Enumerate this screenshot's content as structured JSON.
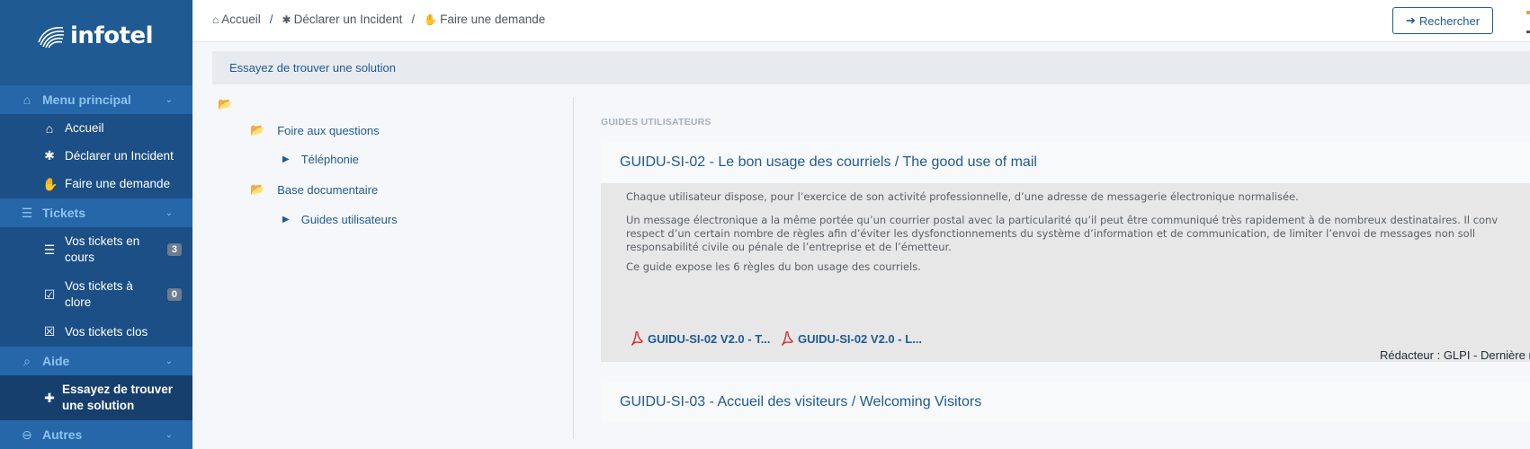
{
  "app": {
    "logo_text": "infotel"
  },
  "sidebar": {
    "sections": [
      {
        "label": "Menu principal",
        "icon": "home-icon"
      },
      {
        "label": "Tickets",
        "icon": "list-icon"
      },
      {
        "label": "Aide",
        "icon": "search-help-icon"
      },
      {
        "label": "Autres",
        "icon": "minus-circle-icon"
      }
    ],
    "items": [
      {
        "label": "Accueil",
        "icon": "home-icon"
      },
      {
        "label": "Déclarer un Incident",
        "icon": "bug-icon"
      },
      {
        "label": "Faire une demande",
        "icon": "handshake-icon"
      },
      {
        "label": "Vos tickets en cours",
        "label_l1": "Vos tickets en",
        "label_l2": "cours",
        "badge": "3",
        "icon": "list-icon"
      },
      {
        "label": "Vos tickets à clore",
        "label_l1": "Vos tickets à",
        "label_l2": "clore",
        "badge": "0",
        "icon": "checklist-icon"
      },
      {
        "label": "Vos tickets clos",
        "icon": "close-box-icon"
      },
      {
        "label": "Essayez de trouver une solution",
        "label_l1": "Essayez de trouver",
        "label_l2": "une solution",
        "icon": "medkit-icon"
      }
    ]
  },
  "breadcrumb": {
    "items": [
      {
        "label": "Accueil",
        "icon": "home-icon"
      },
      {
        "label": "Déclarer un Incident",
        "icon": "bug-icon"
      },
      {
        "label": "Faire une demande",
        "icon": "handshake-icon"
      }
    ],
    "separator": "/"
  },
  "search_button": {
    "label": "Rechercher",
    "icon": "arrow-right-icon"
  },
  "solution_header": "Essayez de trouver une solution",
  "tree": {
    "nodes": [
      {
        "label": "Foire aux questions",
        "icon": "folder-open-icon"
      },
      {
        "label": "Téléphonie",
        "icon": "caret-right-icon"
      },
      {
        "label": "Base documentaire",
        "icon": "folder-open-icon"
      },
      {
        "label": "Guides utilisateurs",
        "icon": "caret-right-icon"
      }
    ]
  },
  "content": {
    "group_title": "GUIDES UTILISATEURS",
    "articles": [
      {
        "title": "GUIDU-SI-02 - Le bon usage des courriels / The good use of mail",
        "para1": "Chaque utilisateur dispose, pour l’exercice de son activité professionnelle, d’une adresse de messagerie électronique normalisée.",
        "para2_l1": "Un message électronique a la même portée qu’un courrier postal avec la particularité qu’il peut être communiqué très rapidement à de nombreux destinataires. Il conv",
        "para2_l2": "respect d’un certain nombre de règles afin d’éviter les dysfonctionnements du système d’information et de communication, de limiter l’envoi de messages non soll",
        "para2_l3": "responsabilité civile ou pénale de l’entreprise et de l’émetteur.",
        "para3": "Ce guide expose les 6 règles du bon usage des courriels.",
        "attachments": [
          {
            "label": "GUIDU-SI-02 V2.0 - T...",
            "icon": "pdf-icon"
          },
          {
            "label": "GUIDU-SI-02 V2.0 - L...",
            "icon": "pdf-icon"
          }
        ],
        "meta": "Rédacteur : GLPI - Dernière m"
      },
      {
        "title": "GUIDU-SI-03 - Accueil des visiteurs / Welcoming Visitors"
      }
    ]
  },
  "colors": {
    "sidebar_bg": "#1f5a93",
    "section_bg": "#2567a8",
    "accent": "#1f5a93",
    "badge_bg": "#6b7d8f",
    "pdf_red": "#d4202a"
  }
}
